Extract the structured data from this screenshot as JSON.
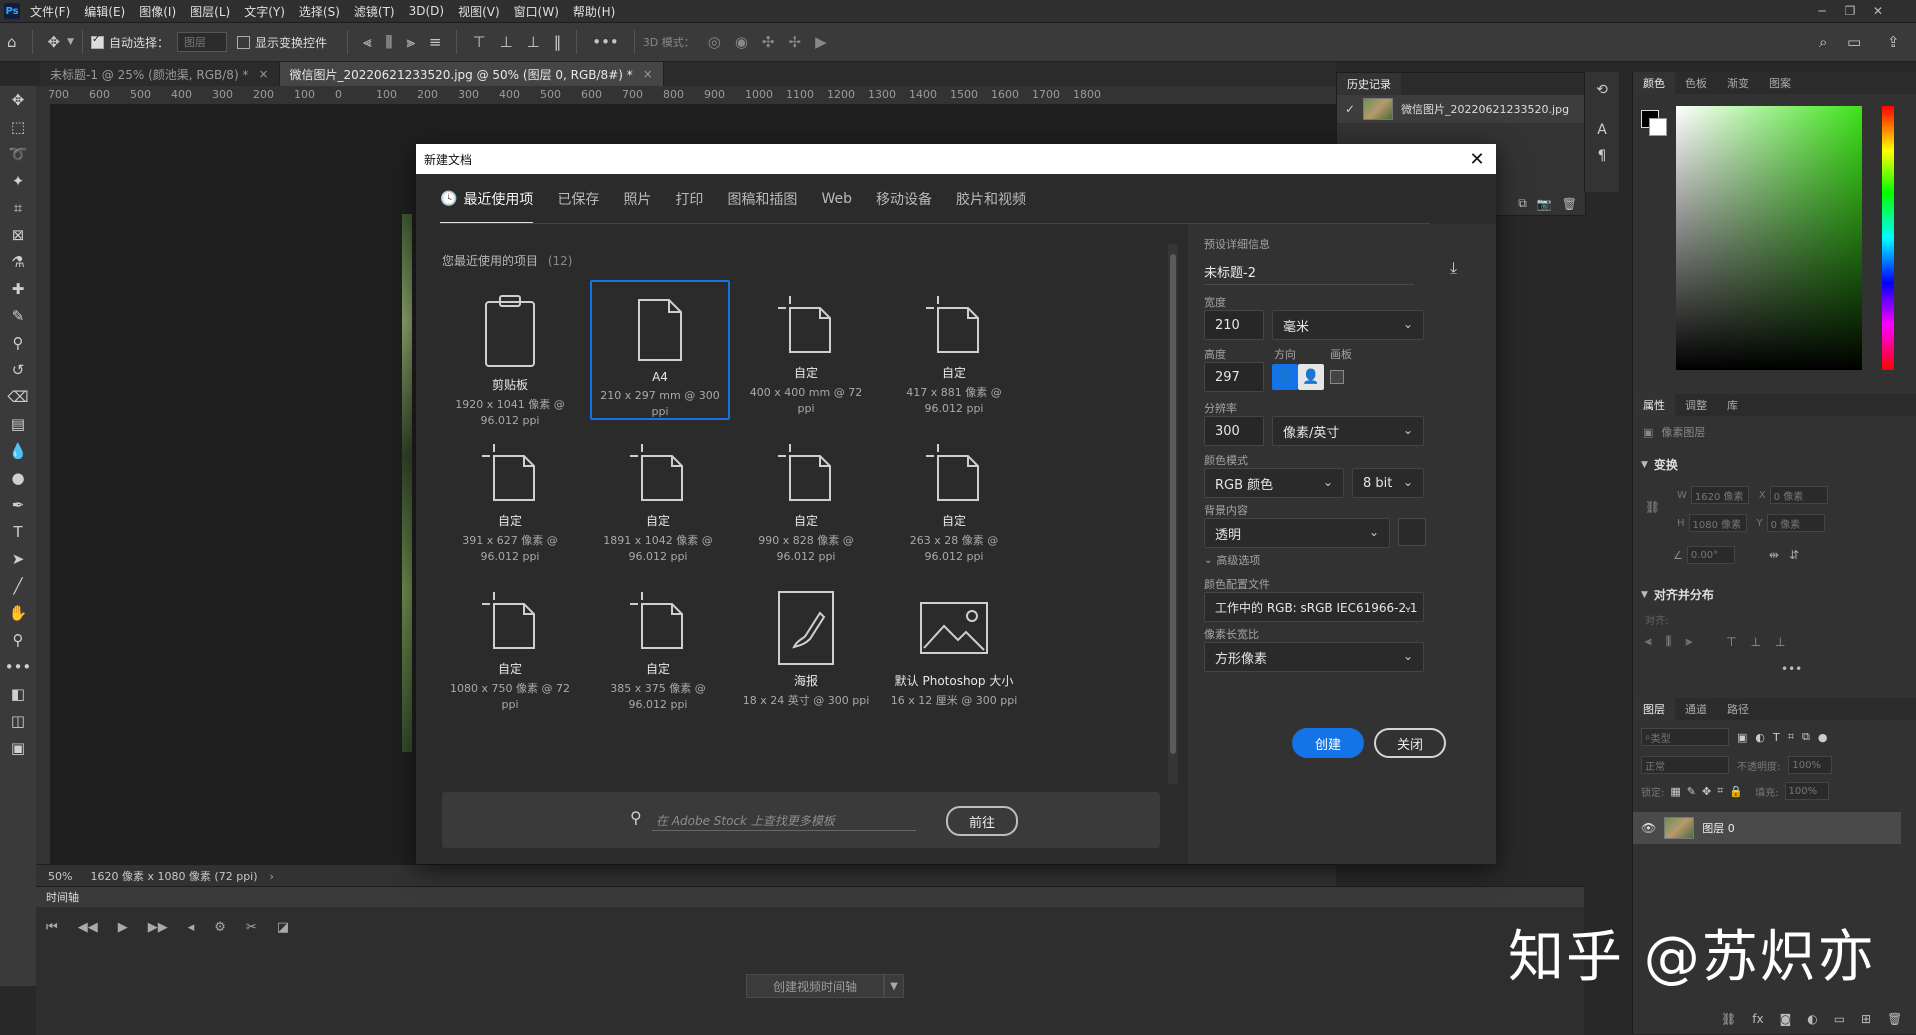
{
  "menubar": {
    "items": [
      "文件(F)",
      "编辑(E)",
      "图像(I)",
      "图层(L)",
      "文字(Y)",
      "选择(S)",
      "滤镜(T)",
      "3D(D)",
      "视图(V)",
      "窗口(W)",
      "帮助(H)"
    ]
  },
  "options": {
    "auto_select_label": "自动选择：",
    "auto_select_value": "图层",
    "show_transform_label": "显示变换控件",
    "mode_3d_label": "3D 模式："
  },
  "doc_tabs": [
    {
      "label": "未标题-1 @ 25% (颜池渠, RGB/8) *"
    },
    {
      "label": "微信图片_20220621233520.jpg @ 50% (图层 0, RGB/8#) *"
    }
  ],
  "ruler_ticks": [
    "700",
    "600",
    "500",
    "400",
    "300",
    "200",
    "100",
    "0",
    "100",
    "200",
    "300",
    "400",
    "500",
    "600",
    "700",
    "800",
    "900",
    "1000",
    "1100",
    "1200",
    "1300",
    "1400",
    "1500",
    "1600",
    "1700",
    "1800"
  ],
  "status": {
    "zoom": "50%",
    "doc_info": "1620 像素 x 1080 像素 (72 ppi)"
  },
  "timeline": {
    "title": "时间轴",
    "create_label": "创建视频时间轴"
  },
  "history": {
    "tabs": [
      "历史记录"
    ],
    "item": "微信图片_20220621233520.jpg"
  },
  "right_panels": {
    "color_tabs": [
      "颜色",
      "色板",
      "渐变",
      "图案"
    ],
    "props_tabs": [
      "属性",
      "调整",
      "库"
    ],
    "props_subtitle": "像素图层",
    "transform_title": "变换",
    "w_label": "W",
    "w_value": "1620 像素",
    "h_label": "H",
    "h_value": "1080 像素",
    "x_label": "X",
    "x_value": "0 像素",
    "y_label": "Y",
    "y_value": "0 像素",
    "angle_value": "0.00°",
    "align_title": "对齐并分布",
    "align_label": "对齐:",
    "layers_tabs": [
      "图层",
      "通道",
      "路径"
    ],
    "layer_filter": "类型",
    "blend_mode": "正常",
    "opacity_label": "不透明度:",
    "opacity_value": "100%",
    "lock_label": "锁定:",
    "fill_label": "填充:",
    "fill_value": "100%",
    "layer_name": "图层 0"
  },
  "watermark": "知乎 @苏炽亦",
  "dialog": {
    "title": "新建文档",
    "tabs": [
      "最近使用项",
      "已保存",
      "照片",
      "打印",
      "图稿和插图",
      "Web",
      "移动设备",
      "胶片和视频"
    ],
    "recent_heading": "您最近使用的项目",
    "recent_count": "(12)",
    "cards": [
      {
        "name": "剪贴板",
        "meta": "1920 x 1041 像素 @ 96.012 ppi",
        "icon": "clipboard-icon"
      },
      {
        "name": "A4",
        "meta": "210 x 297 mm @ 300 ppi",
        "icon": "document-icon"
      },
      {
        "name": "自定",
        "meta": "400 x 400 mm @ 72 ppi",
        "icon": "custom-doc-icon"
      },
      {
        "name": "自定",
        "meta": "417 x 881 像素 @ 96.012 ppi",
        "icon": "custom-doc-icon"
      },
      {
        "name": "自定",
        "meta": "391 x 627 像素 @ 96.012 ppi",
        "icon": "custom-doc-icon"
      },
      {
        "name": "自定",
        "meta": "1891 x 1042 像素 @ 96.012 ppi",
        "icon": "custom-doc-icon"
      },
      {
        "name": "自定",
        "meta": "990 x 828 像素 @ 96.012 ppi",
        "icon": "custom-doc-icon"
      },
      {
        "name": "自定",
        "meta": "263 x 28 像素 @ 96.012 ppi",
        "icon": "custom-doc-icon"
      },
      {
        "name": "自定",
        "meta": "1080 x 750 像素 @ 72 ppi",
        "icon": "custom-doc-icon"
      },
      {
        "name": "自定",
        "meta": "385 x 375 像素 @ 96.012 ppi",
        "icon": "custom-doc-icon"
      },
      {
        "name": "海报",
        "meta": "18 x 24 英寸 @ 300 ppi",
        "icon": "brush-icon"
      },
      {
        "name": "默认 Photoshop 大小",
        "meta": "16 x 12 厘米 @ 300 ppi",
        "icon": "image-icon"
      }
    ],
    "stock_placeholder": "在 Adobe Stock 上查找更多模板",
    "stock_go": "前往",
    "preset": {
      "heading": "预设详细信息",
      "doc_name": "未标题-2",
      "width_label": "宽度",
      "width_value": "210",
      "width_unit": "毫米",
      "height_label": "高度",
      "height_value": "297",
      "orientation_label": "方向",
      "artboard_label": "画板",
      "resolution_label": "分辨率",
      "resolution_value": "300",
      "resolution_unit": "像素/英寸",
      "color_mode_label": "颜色模式",
      "color_mode_value": "RGB 颜色",
      "bit_depth": "8 bit",
      "background_label": "背景内容",
      "background_value": "透明",
      "advanced_label": "高级选项",
      "color_profile_label": "颜色配置文件",
      "color_profile_value": "工作中的 RGB: sRGB IEC61966-2.1",
      "pixel_aspect_label": "像素长宽比",
      "pixel_aspect_value": "方形像素",
      "create_label": "创建",
      "close_label": "关闭"
    }
  }
}
